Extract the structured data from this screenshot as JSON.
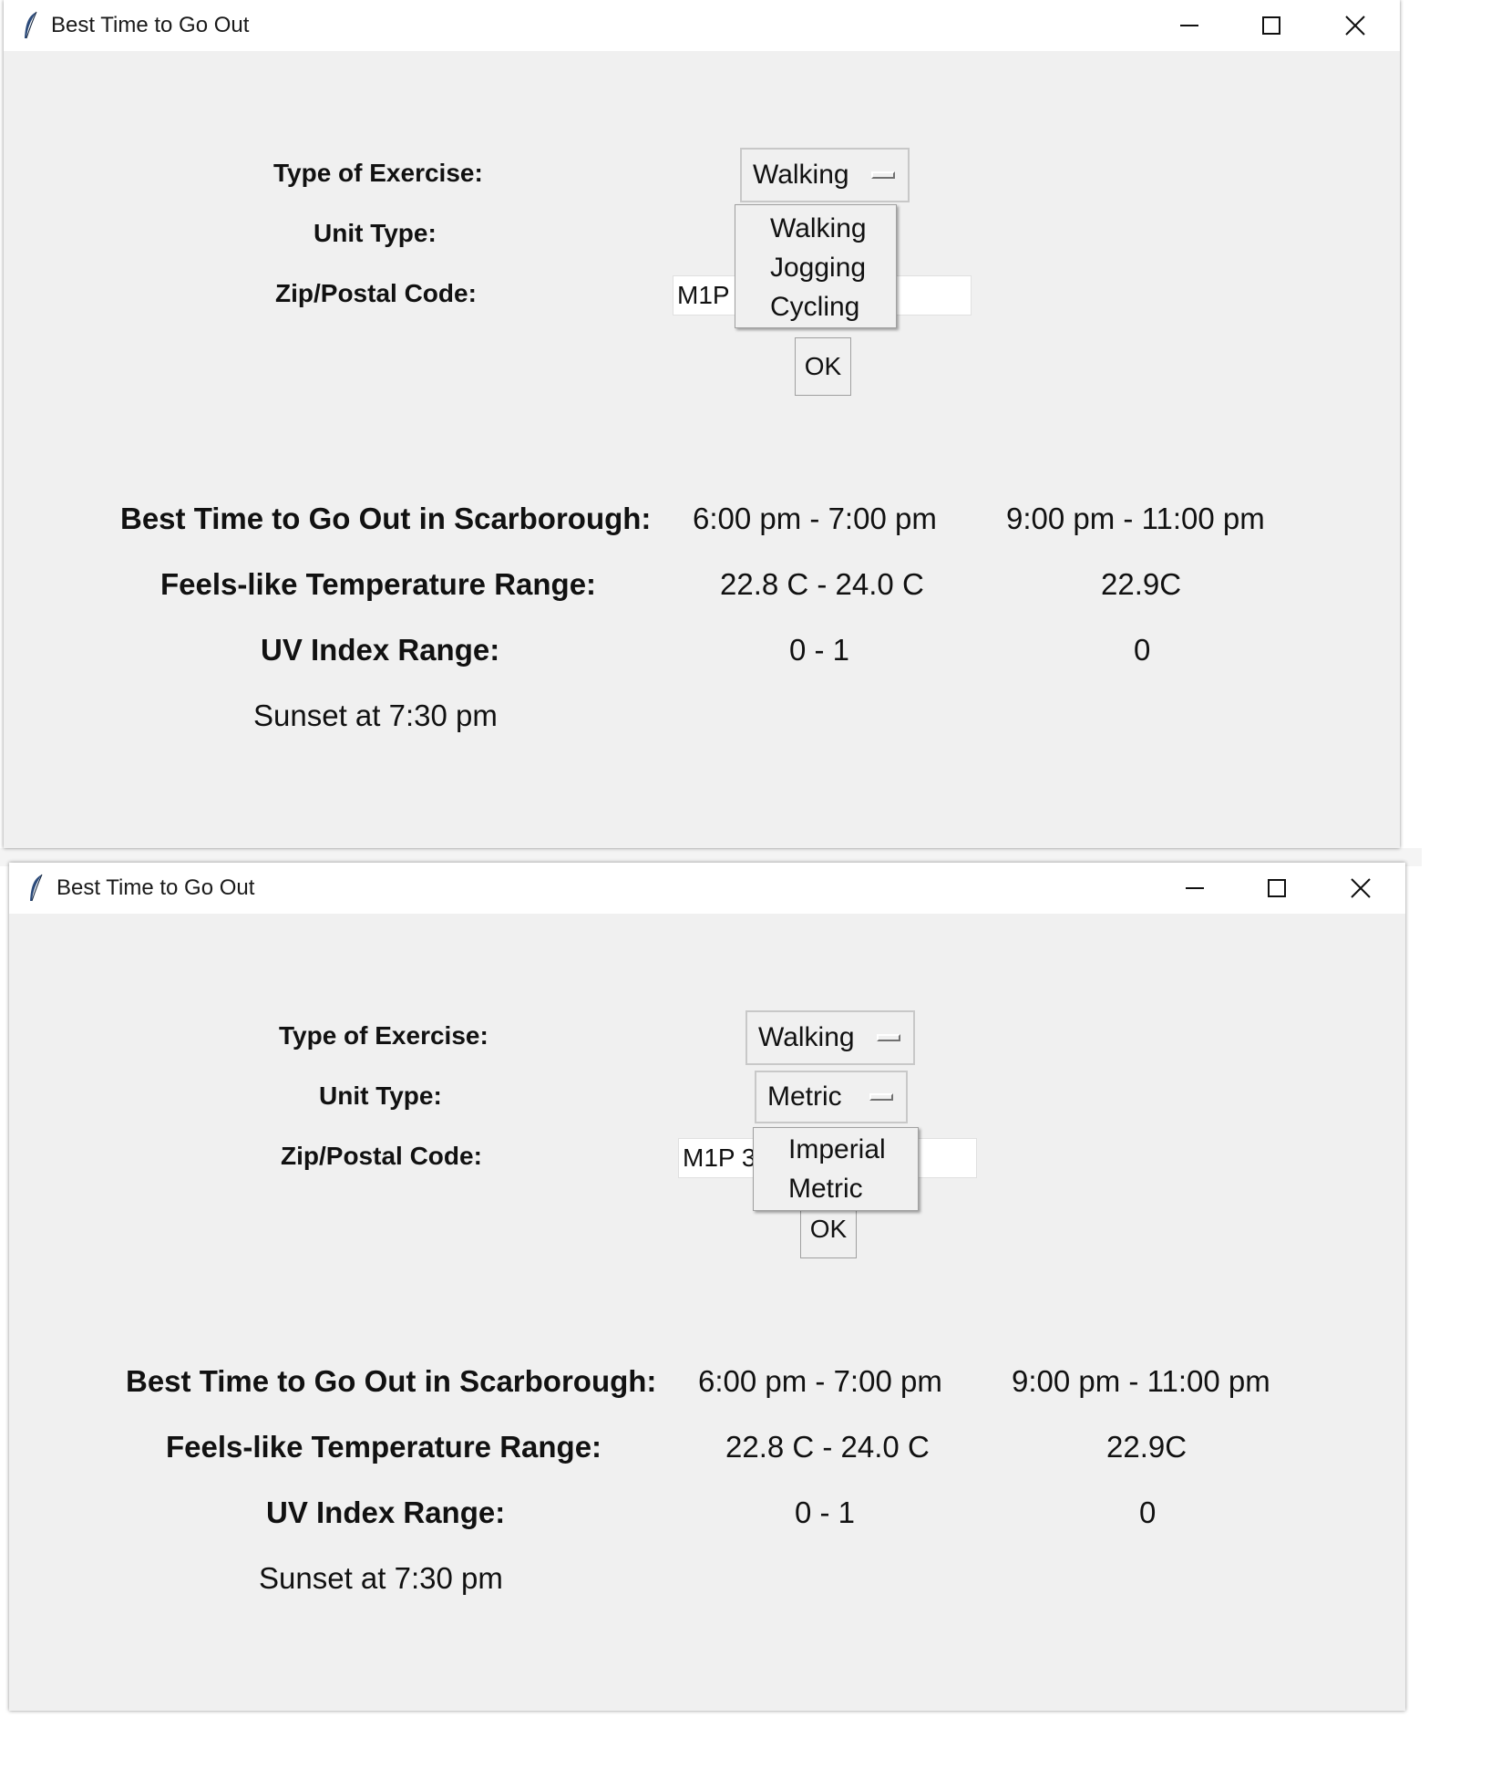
{
  "colors": {
    "window_bg": "#f0f0f0",
    "titlebar_bg": "#ffffff",
    "text": "#111111"
  },
  "windows": [
    {
      "title": "Best Time to Go Out",
      "icons": [
        "feather-icon",
        "minimize-icon",
        "maximize-icon",
        "close-icon"
      ],
      "labels": {
        "exercise": "Type of Exercise:",
        "unit": "Unit Type:",
        "zip": "Zip/Postal Code:"
      },
      "exercise_selected": "Walking",
      "zip_value": "M1P",
      "ok_label": "OK",
      "open_menu": {
        "for": "exercise",
        "options": [
          "Walking",
          "Jogging",
          "Cycling"
        ]
      },
      "results": {
        "best_time_label": "Best Time to Go Out in Scarborough:",
        "best_time_1": "6:00 pm - 7:00 pm",
        "best_time_2": "9:00 pm - 11:00 pm",
        "feels_like_label": "Feels-like Temperature Range:",
        "feels_like_1": "22.8 C - 24.0 C",
        "feels_like_2": "22.9C",
        "uv_label": "UV Index Range:",
        "uv_1": "0 - 1",
        "uv_2": "0",
        "sunset": "Sunset at 7:30 pm"
      }
    },
    {
      "title": "Best Time to Go Out",
      "icons": [
        "feather-icon",
        "minimize-icon",
        "maximize-icon",
        "close-icon"
      ],
      "labels": {
        "exercise": "Type of Exercise:",
        "unit": "Unit Type:",
        "zip": "Zip/Postal Code:"
      },
      "exercise_selected": "Walking",
      "unit_selected": "Metric",
      "zip_value": "M1P 3",
      "ok_label": "OK",
      "open_menu": {
        "for": "unit",
        "options": [
          "Imperial",
          "Metric"
        ]
      },
      "results": {
        "best_time_label": "Best Time to Go Out in Scarborough:",
        "best_time_1": "6:00 pm - 7:00 pm",
        "best_time_2": "9:00 pm - 11:00 pm",
        "feels_like_label": "Feels-like Temperature Range:",
        "feels_like_1": "22.8 C - 24.0 C",
        "feels_like_2": "22.9C",
        "uv_label": "UV Index Range:",
        "uv_1": "0 - 1",
        "uv_2": "0",
        "sunset": "Sunset at 7:30 pm"
      }
    }
  ]
}
